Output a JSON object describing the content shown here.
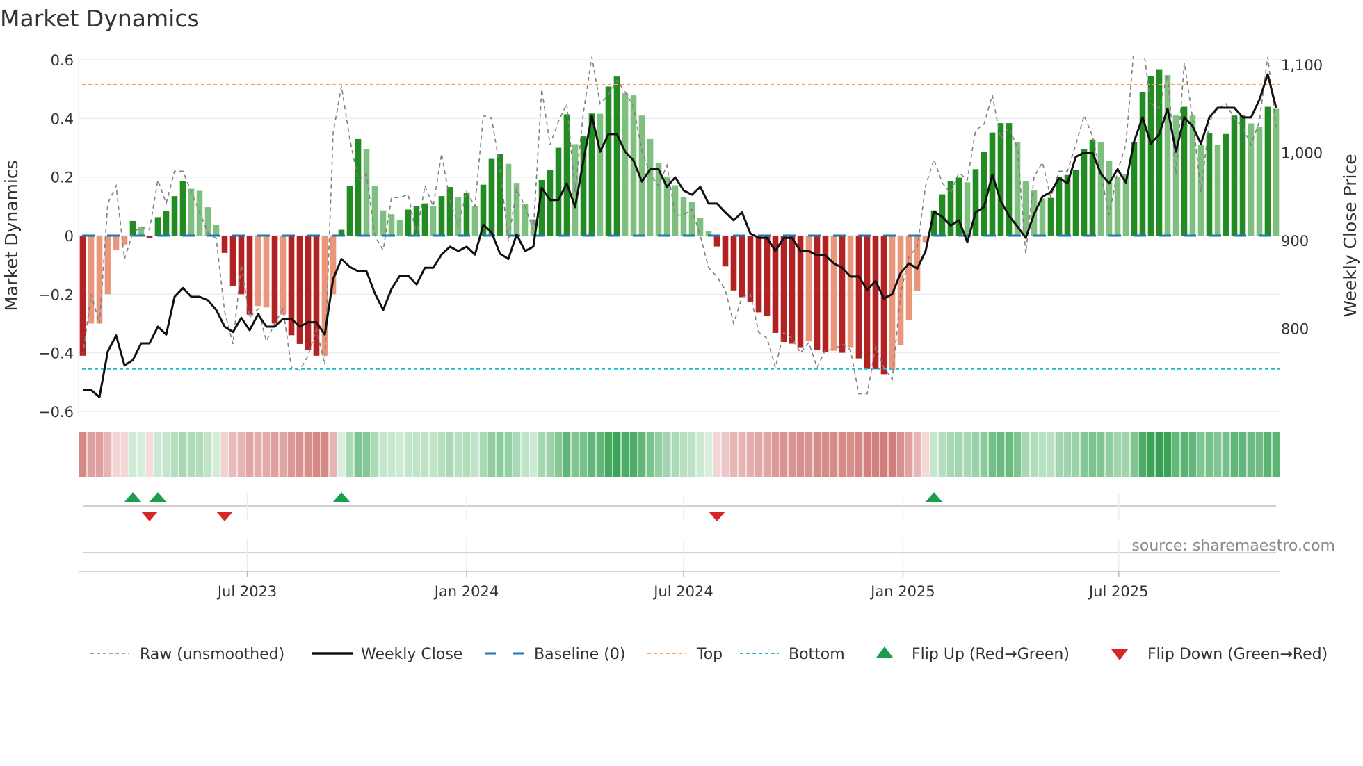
{
  "chart_data": {
    "type": "bar",
    "title": "Market Dynamics",
    "ylabel": "Market Dynamics",
    "y2label": "Weekly Close Price",
    "ylim": [
      -0.62,
      0.62
    ],
    "y2lim": [
      712,
      1115
    ],
    "yticks": [
      {
        "value": 0.6,
        "label": "0.6"
      },
      {
        "value": 0.4,
        "label": "0.4"
      },
      {
        "value": 0.2,
        "label": "0.2"
      },
      {
        "value": 0,
        "label": "0"
      },
      {
        "value": -0.2,
        "label": "−0.2"
      },
      {
        "value": -0.4,
        "label": "−0.4"
      },
      {
        "value": -0.6,
        "label": "−0.6"
      }
    ],
    "y2ticks": [
      {
        "value": 1100,
        "label": "1,100"
      },
      {
        "value": 1000,
        "label": "1,000"
      },
      {
        "value": 900,
        "label": "900"
      },
      {
        "value": 800,
        "label": "800"
      }
    ],
    "x_start": "2023-02-13",
    "x_interval": "weekly",
    "xticks": [
      {
        "date": "2023-07-01",
        "label": "Jul 2023"
      },
      {
        "date": "2024-01-01",
        "label": "Jan 2024"
      },
      {
        "date": "2024-07-01",
        "label": "Jul 2024"
      },
      {
        "date": "2025-01-01",
        "label": "Jan 2025"
      },
      {
        "date": "2025-07-01",
        "label": "Jul 2025"
      }
    ],
    "thresholds": {
      "baseline": 0,
      "top": 0.515,
      "bottom": -0.455
    },
    "colors": {
      "bar_pos_strong": "#228b22",
      "bar_pos_weak": "#7fbf7f",
      "bar_neg_strong": "#b22222",
      "bar_neg_weak": "#e9967a",
      "raw": "#808080",
      "close": "#111111",
      "baseline": "#1f77b4",
      "top": "#f4a460",
      "bottom": "#17becf",
      "flip_up": "#1a9e4a",
      "flip_down": "#d62728"
    },
    "series": [
      {
        "name": "Market Dynamics (smoothed)",
        "values": [
          -0.41,
          -0.3,
          -0.3,
          -0.2,
          -0.05,
          -0.03,
          0.05,
          0.03,
          -0.007,
          0.063,
          0.085,
          0.135,
          0.186,
          0.16,
          0.153,
          0.097,
          0.037,
          -0.059,
          -0.173,
          -0.2,
          -0.27,
          -0.24,
          -0.245,
          -0.3,
          -0.27,
          -0.34,
          -0.37,
          -0.39,
          -0.41,
          -0.41,
          -0.2,
          0.02,
          0.17,
          0.33,
          0.295,
          0.17,
          0.086,
          0.073,
          0.054,
          0.089,
          0.1,
          0.11,
          0.102,
          0.135,
          0.166,
          0.131,
          0.145,
          0.1,
          0.174,
          0.262,
          0.278,
          0.245,
          0.18,
          0.107,
          0.056,
          0.19,
          0.225,
          0.3,
          0.414,
          0.312,
          0.339,
          0.417,
          0.416,
          0.509,
          0.543,
          0.486,
          0.479,
          0.41,
          0.33,
          0.249,
          0.202,
          0.172,
          0.133,
          0.115,
          0.06,
          0.015,
          -0.037,
          -0.105,
          -0.187,
          -0.21,
          -0.226,
          -0.262,
          -0.273,
          -0.332,
          -0.363,
          -0.369,
          -0.381,
          -0.361,
          -0.391,
          -0.398,
          -0.393,
          -0.4,
          -0.381,
          -0.419,
          -0.455,
          -0.456,
          -0.473,
          -0.459,
          -0.375,
          -0.289,
          -0.188,
          -0.022,
          0.086,
          0.141,
          0.186,
          0.198,
          0.182,
          0.227,
          0.286,
          0.352,
          0.384,
          0.384,
          0.32,
          0.186,
          0.156,
          0.127,
          0.129,
          0.2,
          0.207,
          0.225,
          0.296,
          0.328,
          0.32,
          0.256,
          0.2,
          0.21,
          0.32,
          0.49,
          0.545,
          0.568,
          0.548,
          0.41,
          0.44,
          0.41,
          0.31,
          0.35,
          0.31,
          0.347,
          0.41,
          0.41,
          0.383,
          0.37,
          0.44,
          0.433
        ],
        "strong": [
          1,
          0,
          0,
          0,
          0,
          0,
          1,
          0,
          1,
          1,
          1,
          1,
          1,
          0,
          0,
          0,
          0,
          1,
          1,
          1,
          1,
          0,
          0,
          1,
          0,
          1,
          1,
          1,
          1,
          0,
          0,
          1,
          1,
          1,
          0,
          0,
          0,
          0,
          0,
          1,
          1,
          1,
          0,
          1,
          1,
          0,
          1,
          0,
          1,
          1,
          1,
          0,
          0,
          0,
          0,
          1,
          1,
          1,
          1,
          0,
          1,
          1,
          0,
          1,
          1,
          0,
          0,
          0,
          0,
          0,
          0,
          0,
          0,
          0,
          0,
          0,
          1,
          1,
          1,
          1,
          1,
          1,
          1,
          1,
          1,
          1,
          1,
          0,
          1,
          1,
          0,
          1,
          0,
          1,
          1,
          1,
          1,
          0,
          0,
          0,
          0,
          0,
          1,
          1,
          1,
          1,
          0,
          1,
          1,
          1,
          1,
          1,
          0,
          0,
          0,
          0,
          1,
          1,
          1,
          1,
          1,
          1,
          0,
          0,
          0,
          0,
          1,
          1,
          1,
          1,
          0,
          0,
          1,
          0,
          0,
          1,
          0,
          1,
          1,
          1,
          0,
          0,
          1,
          0
        ]
      },
      {
        "name": "Raw (unsmoothed)",
        "values": [
          -0.41,
          -0.2,
          -0.3,
          0.11,
          0.17,
          -0.08,
          0.01,
          0.03,
          0.02,
          0.19,
          0.11,
          0.22,
          0.22,
          0.15,
          0.08,
          0.01,
          -0.01,
          -0.26,
          -0.37,
          -0.1,
          -0.28,
          -0.25,
          -0.36,
          -0.3,
          -0.25,
          -0.45,
          -0.46,
          -0.41,
          -0.32,
          -0.44,
          0.35,
          0.51,
          0.33,
          0.19,
          0.21,
          0.0,
          -0.05,
          0.13,
          0.13,
          0.14,
          0.0,
          0.17,
          0.1,
          0.28,
          0.12,
          0.035,
          0.15,
          0.1,
          0.41,
          0.4,
          0.23,
          -0.02,
          0.16,
          0.1,
          0.02,
          0.5,
          0.31,
          0.39,
          0.45,
          0.15,
          0.42,
          0.61,
          0.45,
          0.48,
          0.53,
          0.49,
          0.44,
          0.29,
          0.21,
          0.17,
          0.24,
          0.07,
          0.07,
          0.09,
          0.0,
          -0.11,
          -0.14,
          -0.185,
          -0.3,
          -0.21,
          -0.2,
          -0.33,
          -0.35,
          -0.45,
          -0.33,
          -0.35,
          -0.4,
          -0.365,
          -0.45,
          -0.39,
          -0.39,
          -0.37,
          -0.39,
          -0.54,
          -0.54,
          -0.38,
          -0.45,
          -0.49,
          -0.2,
          -0.07,
          -0.04,
          0.17,
          0.26,
          0.18,
          0.145,
          0.215,
          0.19,
          0.36,
          0.38,
          0.48,
          0.33,
          0.37,
          0.3,
          -0.06,
          0.2,
          0.25,
          0.13,
          0.22,
          0.22,
          0.31,
          0.41,
          0.34,
          0.21,
          0.07,
          0.22,
          0.31,
          0.65,
          0.66,
          0.45,
          0.435,
          0.55,
          0.21,
          0.59,
          0.4,
          0.15,
          0.39,
          0.435,
          0.45,
          0.4,
          0.37,
          0.31,
          0.39,
          0.61,
          0.37
        ]
      },
      {
        "name": "Weekly Close",
        "axis": "right",
        "values": [
          730,
          730,
          722,
          774,
          792,
          758,
          764,
          783,
          783,
          802,
          793,
          836,
          846,
          836,
          836,
          832,
          821,
          802,
          796,
          812,
          798,
          816,
          802,
          802,
          811,
          811,
          802,
          807,
          807,
          793,
          856,
          879,
          870,
          865,
          865,
          840,
          821,
          845,
          860,
          860,
          850,
          869,
          869,
          884,
          893,
          888,
          893,
          884,
          918,
          909,
          885,
          879,
          907,
          888,
          893,
          960,
          946,
          946,
          965,
          938,
          991,
          1042,
          1001,
          1021,
          1021,
          1001,
          991,
          967,
          981,
          981,
          961,
          972,
          957,
          952,
          961,
          942,
          942,
          932,
          923,
          932,
          908,
          903,
          903,
          888,
          903,
          903,
          888,
          888,
          883,
          883,
          874,
          869,
          859,
          859,
          844,
          854,
          834,
          839,
          863,
          874,
          868,
          888,
          933,
          927,
          917,
          923,
          898,
          932,
          938,
          975,
          945,
          928,
          916,
          903,
          930,
          950,
          955,
          971,
          965,
          995,
          1000,
          1000,
          976,
          965,
          981,
          966,
          1013,
          1040,
          1010,
          1021,
          1050,
          1001,
          1040,
          1030,
          1010,
          1040,
          1051,
          1051,
          1051,
          1040,
          1040,
          1060,
          1089,
          1051
        ]
      }
    ],
    "legend": {
      "placement": "bottom",
      "items": [
        {
          "key": "raw",
          "label": "Raw (unsmoothed)"
        },
        {
          "key": "close",
          "label": "Weekly Close"
        },
        {
          "key": "baseline",
          "label": "Baseline (0)"
        },
        {
          "key": "top",
          "label": "Top"
        },
        {
          "key": "bottom",
          "label": "Bottom"
        },
        {
          "key": "flip_up",
          "label": "Flip Up (Red→Green)"
        },
        {
          "key": "flip_down",
          "label": "Flip Down (Green→Red)"
        }
      ]
    },
    "annotation": "source: sharemaestro.com"
  }
}
